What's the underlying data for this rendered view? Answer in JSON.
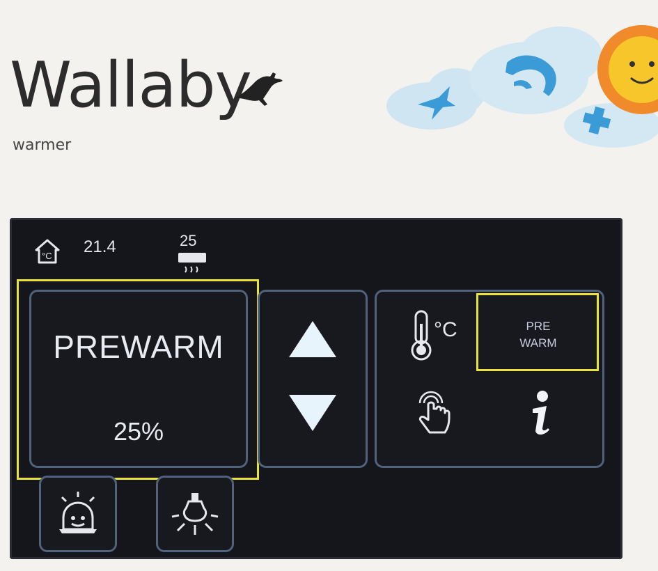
{
  "brand": {
    "name": "Wallaby",
    "subtitle": "warmer"
  },
  "status": {
    "room_temp": "21.4",
    "heater_level": "25"
  },
  "mode": {
    "title": "PREWARM",
    "power": "25%"
  },
  "menu": {
    "temp_icon": "thermometer-celsius-icon",
    "prewarm_line1": "PRE",
    "prewarm_line2": "WARM",
    "touch_icon": "touch-hand-icon",
    "info_icon": "info-icon"
  },
  "bottom_buttons": [
    {
      "icon": "alarm-icon"
    },
    {
      "icon": "lamp-icon"
    }
  ],
  "colors": {
    "screen_bg": "#15161c",
    "panel_border": "#51627c",
    "highlight": "#e8e23a",
    "text": "#e8ecf2",
    "sun": "#f7a820",
    "cloud": "#cfe5f2",
    "accent_blue": "#3a9bd6"
  }
}
